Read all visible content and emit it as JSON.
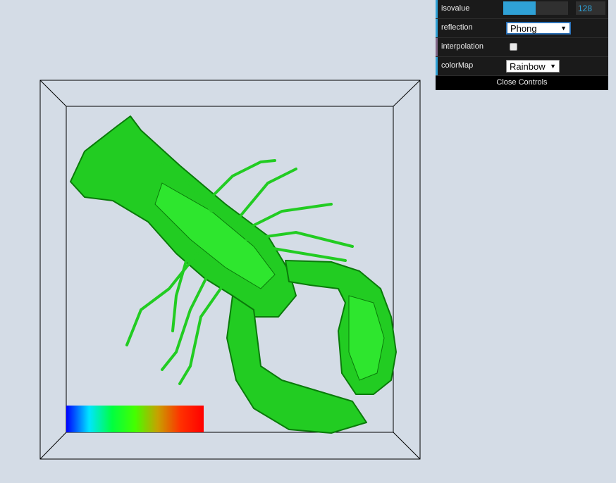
{
  "viewer": {
    "colorbar_gradient": [
      "#0000ff",
      "#00e5ff",
      "#00ff40",
      "#44ff00",
      "#c8a000",
      "#ff3000",
      "#ff0000"
    ],
    "surface_color": "#22cc22",
    "surface_edge": "#0a7a0a",
    "box_stroke": "#000000"
  },
  "controls": {
    "isovalue": {
      "label": "isovalue",
      "value": "128",
      "level": 0.5
    },
    "reflection": {
      "label": "reflection",
      "value": "Phong"
    },
    "interpolation": {
      "label": "interpolation",
      "checked": false
    },
    "colormap": {
      "label": "colorMap",
      "value": "Rainbow"
    },
    "close_label": "Close Controls"
  },
  "icons": {
    "dropdown": "chevron-down-icon"
  }
}
